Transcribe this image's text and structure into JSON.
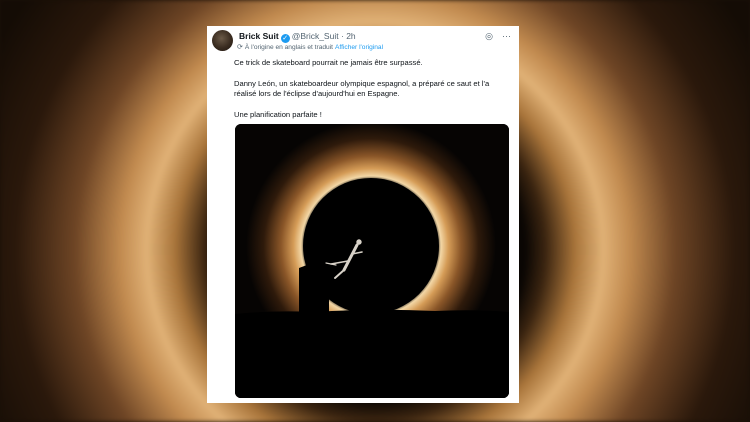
{
  "tweet": {
    "author_name": "Brick Suit",
    "author_handle": "@Brick_Suit",
    "separator": "·",
    "time": "2h",
    "translation_note": "À l'origine en anglais et traduit",
    "show_original": "Afficher l'original",
    "text_lines": [
      "Ce trick de skateboard pourrait ne jamais être surpassé.",
      "Danny León, un skateboardeur olympique espagnol, a préparé ce saut et l'a réalisé lors de l'éclipse d'aujourd'hui en Espagne.",
      "Une planification parfaite !"
    ],
    "media_alt": "skater silhouette jumping in front of solar eclipse"
  },
  "icons": {
    "verified": "verified-badge-icon",
    "translate": "translate-icon",
    "grok": "grok-icon",
    "more": "more-icon"
  },
  "colors": {
    "accent": "#1d9bf0",
    "text": "#0f1419",
    "muted": "#536471",
    "corona": "#e0b176"
  }
}
